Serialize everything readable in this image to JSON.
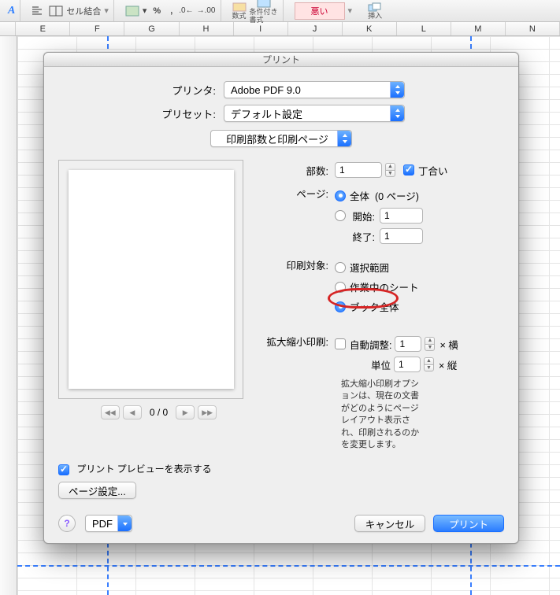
{
  "ribbon": {
    "merge_label": "セル結合",
    "formula_label": "数式",
    "conditional_line1": "条件付き",
    "conditional_line2": "書式",
    "style_bad": "悪い",
    "insert_label": "挿入"
  },
  "columns": [
    "",
    "E",
    "F",
    "G",
    "H",
    "I",
    "J",
    "K",
    "L",
    "M",
    "N"
  ],
  "dialog": {
    "title": "プリント",
    "printer_label": "プリンタ:",
    "printer_value": "Adobe PDF 9.0",
    "preset_label": "プリセット:",
    "preset_value": "デフォルト設定",
    "section_value": "印刷部数と印刷ページ",
    "copies": {
      "label": "部数:",
      "value": "1",
      "collate_label": "丁合い",
      "collate_checked": true
    },
    "pages": {
      "label": "ページ:",
      "all_label": "全体",
      "all_count": "(0 ページ)",
      "from_label": "開始:",
      "from_value": "1",
      "to_label": "終了:",
      "to_value": "1",
      "selected": "all"
    },
    "target": {
      "label": "印刷対象:",
      "selection_label": "選択範囲",
      "active_sheets_label": "作業中のシート",
      "workbook_label": "ブック全体",
      "selected": "workbook"
    },
    "scale": {
      "label": "拡大縮小印刷:",
      "autofit_label": "自動調整:",
      "autofit_checked": false,
      "width_value": "1",
      "width_suffix": "× 横",
      "unit_label": "単位",
      "height_value": "1",
      "height_suffix": "× 縦",
      "note": "拡大縮小印刷オプションは、現在の文書がどのようにページ レイアウト表示され、印刷されるのかを変更します。"
    },
    "pager": {
      "text": "0 / 0"
    },
    "show_preview_label": "プリント プレビューを表示する",
    "show_preview_checked": true,
    "page_setup_label": "ページ設定...",
    "help_label": "?",
    "pdf_label": "PDF",
    "cancel_label": "キャンセル",
    "print_label": "プリント"
  }
}
